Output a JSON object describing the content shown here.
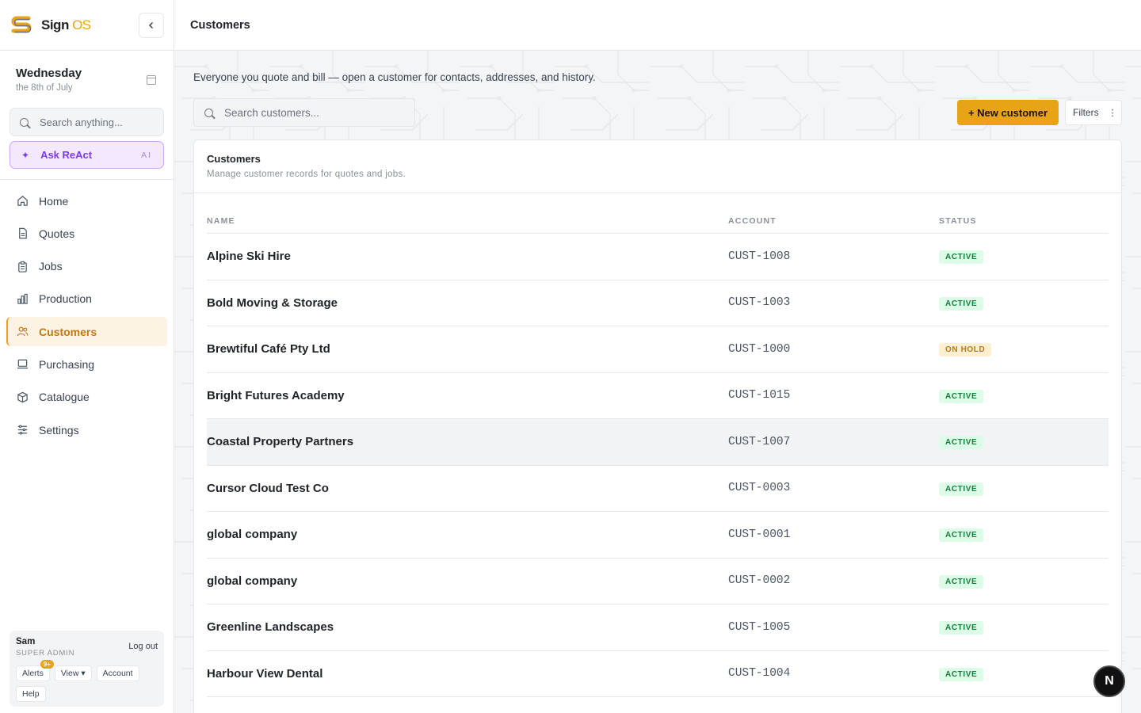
{
  "app": {
    "brand_name": "Sign",
    "brand_suffix": "OS"
  },
  "sidebar": {
    "date_day": "Wednesday",
    "date_sub": "the 8th of July",
    "search_placeholder": "Search anything...",
    "ask_label": "Ask ReAct",
    "ask_badge": "AI",
    "items": [
      {
        "label": "Home",
        "icon": "home-icon"
      },
      {
        "label": "Quotes",
        "icon": "document-icon"
      },
      {
        "label": "Jobs",
        "icon": "clipboard-icon"
      },
      {
        "label": "Production",
        "icon": "bar-chart-icon"
      },
      {
        "label": "Customers",
        "icon": "users-icon",
        "active": true
      },
      {
        "label": "Purchasing",
        "icon": "monitor-icon"
      },
      {
        "label": "Catalogue",
        "icon": "box-icon"
      },
      {
        "label": "Settings",
        "icon": "sliders-icon"
      }
    ],
    "user": {
      "name": "Sam",
      "role": "SUPER ADMIN",
      "logout": "Log out",
      "alerts": "Alerts",
      "alerts_badge": "9+",
      "view": "View ▾",
      "account": "Account",
      "help": "Help"
    }
  },
  "header": {
    "title": "Customers"
  },
  "main": {
    "intro": "Everyone you quote and bill — open a customer for contacts, addresses, and history.",
    "search_placeholder": "Search customers...",
    "new_button": "+ New customer",
    "filters_button": "Filters",
    "card_title": "Customers",
    "card_subtitle": "Manage customer records for quotes and jobs.",
    "columns": [
      "NAME",
      "ACCOUNT",
      "STATUS"
    ],
    "rows": [
      {
        "name": "Alpine Ski Hire",
        "account": "CUST-1008",
        "status": "ACTIVE"
      },
      {
        "name": "Bold Moving & Storage",
        "account": "CUST-1003",
        "status": "ACTIVE"
      },
      {
        "name": "Brewtiful Café Pty Ltd",
        "account": "CUST-1000",
        "status": "ON HOLD"
      },
      {
        "name": "Bright Futures Academy",
        "account": "CUST-1015",
        "status": "ACTIVE"
      },
      {
        "name": "Coastal Property Partners",
        "account": "CUST-1007",
        "status": "ACTIVE"
      },
      {
        "name": "Cursor Cloud Test Co",
        "account": "CUST-0003",
        "status": "ACTIVE"
      },
      {
        "name": "global company",
        "account": "CUST-0001",
        "status": "ACTIVE"
      },
      {
        "name": "global company",
        "account": "CUST-0002",
        "status": "ACTIVE"
      },
      {
        "name": "Greenline Landscapes",
        "account": "CUST-1005",
        "status": "ACTIVE"
      },
      {
        "name": "Harbour View Dental",
        "account": "CUST-1004",
        "status": "ACTIVE"
      }
    ]
  },
  "fab_label": "N",
  "colors": {
    "accent": "#e8a317",
    "ai_purple": "#7c3aed",
    "active_status": "#15803d",
    "hold_status": "#b7791f"
  }
}
